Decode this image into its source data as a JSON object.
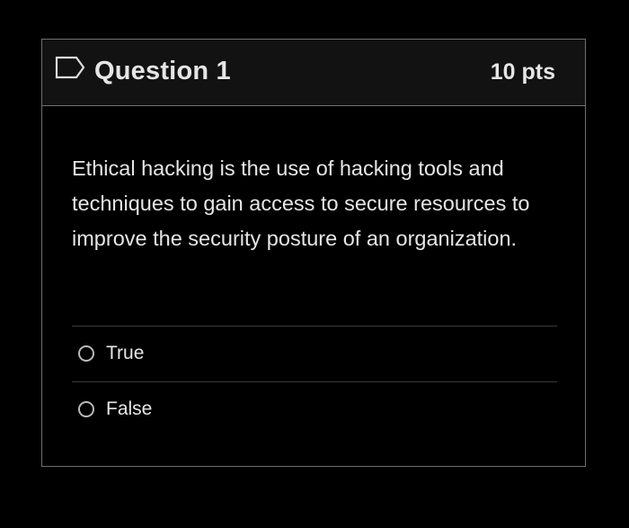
{
  "question": {
    "title": "Question 1",
    "points": "10 pts",
    "flag_icon": "flag-outline-icon",
    "text": "Ethical hacking is the use of hacking tools and techniques to gain access to secure resources to improve the security posture of an organization."
  },
  "answers": [
    {
      "label": "True",
      "selected": false
    },
    {
      "label": "False",
      "selected": false
    }
  ],
  "colors": {
    "background": "#000000",
    "header_background": "#121212",
    "border": "#6f6f6f",
    "text": "#e6e6e6"
  }
}
